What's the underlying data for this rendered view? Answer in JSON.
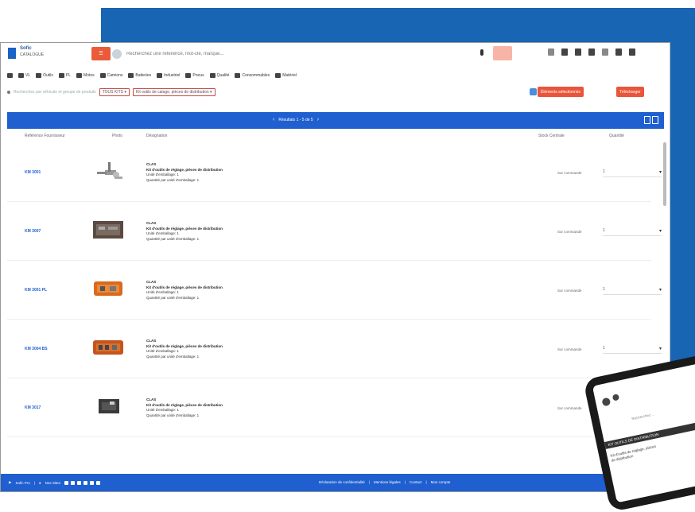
{
  "header": {
    "logo_title": "Sofic",
    "logo_subtitle": "CATALOGUE",
    "menu_label": "",
    "search_placeholder": "Recherchez une référence, mot-clé, marque..."
  },
  "catnav": {
    "items": [
      "VL",
      "Outils",
      "PL",
      "Motos",
      "Camions",
      "Batteries",
      "Industriel",
      "Pneus",
      "Qualité",
      "Consommables",
      "Matériel"
    ]
  },
  "filters": {
    "selector_placeholder": "Recherchez par véhicule et groupe de produits",
    "select_1": "TOUS KITS",
    "select_2": "Kit outils de calage, pièces de distribution",
    "btn_1": "Éléments sélectionnés",
    "btn_2": "Télécharger"
  },
  "results": {
    "pager_text": "Résultats 1 - 5 de 5",
    "prev_arrow": "‹",
    "next_arrow": "›"
  },
  "table": {
    "headers": {
      "ref": "Référence Fournisseur",
      "image": "Photo",
      "designation": "Désignation",
      "stock": "Stock Centrale",
      "qty": "Quantité"
    },
    "rows": [
      {
        "ref": "KM 3001",
        "brand": "CLAS",
        "title": "Kit d'outils de réglage, pièces de distribution",
        "unit": "Unité d'emballage: 1",
        "minqty": "Quantité par unité d'emballage: 1",
        "stock": "Sur commande",
        "qty": "1"
      },
      {
        "ref": "KM 3007",
        "brand": "CLAS",
        "title": "Kit d'outils de réglage, pièces de distribution",
        "unit": "Unité d'emballage: 1",
        "minqty": "Quantité par unité d'emballage: 1",
        "stock": "Sur commande",
        "qty": "1"
      },
      {
        "ref": "KM 3001 PL",
        "brand": "CLAS",
        "title": "Kit d'outils de réglage, pièces de distribution",
        "unit": "Unité d'emballage: 1",
        "minqty": "Quantité par unité d'emballage: 1",
        "stock": "Sur commande",
        "qty": "1"
      },
      {
        "ref": "KM 3004 BS",
        "brand": "CLAS",
        "title": "Kit d'outils de réglage, pièces de distribution",
        "unit": "Unité d'emballage: 1",
        "minqty": "Quantité par unité d'emballage: 1",
        "stock": "Sur commande",
        "qty": "1"
      },
      {
        "ref": "KM 3017",
        "brand": "CLAS",
        "title": "Kit d'outils de réglage, pièces de distribution",
        "unit": "Unité d'emballage: 1",
        "minqty": "Quantité par unité d'emballage: 1",
        "stock": "Sur commande",
        "qty": "1"
      }
    ]
  },
  "footer": {
    "left_1": "Sofic Pro",
    "left_2": "Nos Sites",
    "right_1": "Déclaration de confidentialité",
    "right_2": "Mentions légales",
    "right_3": "Contact",
    "right_4": "Mon compte"
  },
  "tablet": {
    "search_text": "Recherchez...",
    "bar_text": "KIT OUTILS DE DISTRIBUTION",
    "body_text": "Kit d'outils de réglage, pièces de distribution"
  },
  "colors": {
    "brand_blue": "#1f5fd0",
    "panel_blue": "#1765b3",
    "accent_orange": "#e8553a"
  }
}
